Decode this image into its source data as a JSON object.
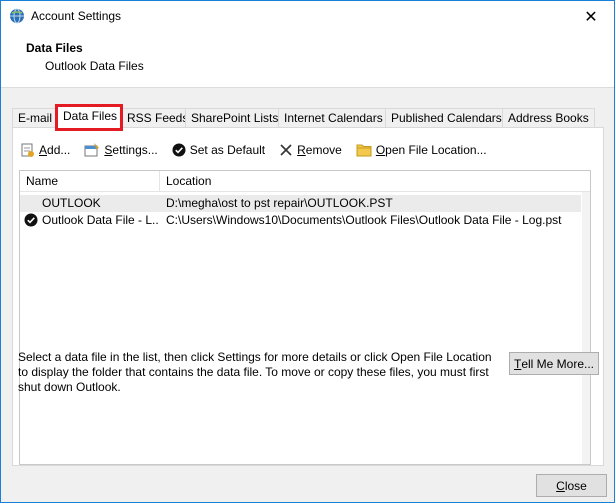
{
  "window": {
    "title": "Account Settings",
    "close_glyph": "✕",
    "icon": "outlook-globe-icon"
  },
  "header": {
    "title": "Data Files",
    "subtitle": "Outlook Data Files"
  },
  "tabs": [
    {
      "label": "E-mail",
      "active": false
    },
    {
      "label": "Data Files",
      "active": true
    },
    {
      "label": "RSS Feeds",
      "active": false
    },
    {
      "label": "SharePoint Lists",
      "active": false
    },
    {
      "label": "Internet Calendars",
      "active": false
    },
    {
      "label": "Published Calendars",
      "active": false
    },
    {
      "label": "Address Books",
      "active": false
    }
  ],
  "toolbar": {
    "add_first": "A",
    "add_rest": "dd...",
    "settings_first": "S",
    "settings_rest": "ettings...",
    "set_default_label": "Set as Default",
    "remove_first": "R",
    "remove_rest": "emove",
    "open_first": "O",
    "open_rest": "pen File Location..."
  },
  "list": {
    "columns": {
      "name": "Name",
      "location": "Location"
    },
    "rows": [
      {
        "name": "OUTLOOK",
        "location": "D:\\megha\\ost to pst repair\\OUTLOOK.PST",
        "default": false,
        "selected": true
      },
      {
        "name": "Outlook Data File - L...",
        "location": "C:\\Users\\Windows10\\Documents\\Outlook Files\\Outlook Data File - Log.pst",
        "default": true,
        "selected": false
      }
    ]
  },
  "description": "Select a data file in the list, then click Settings for more details or click Open File Location to display the folder that contains the data file. To move or copy these files, you must first shut down Outlook.",
  "buttons": {
    "tell_first": "T",
    "tell_rest": "ell Me More...",
    "close_first": "C",
    "close_rest": "lose"
  },
  "colors": {
    "highlight_border": "#e41b23",
    "window_border": "#1a7fd6",
    "selected_row": "#ebebeb"
  }
}
